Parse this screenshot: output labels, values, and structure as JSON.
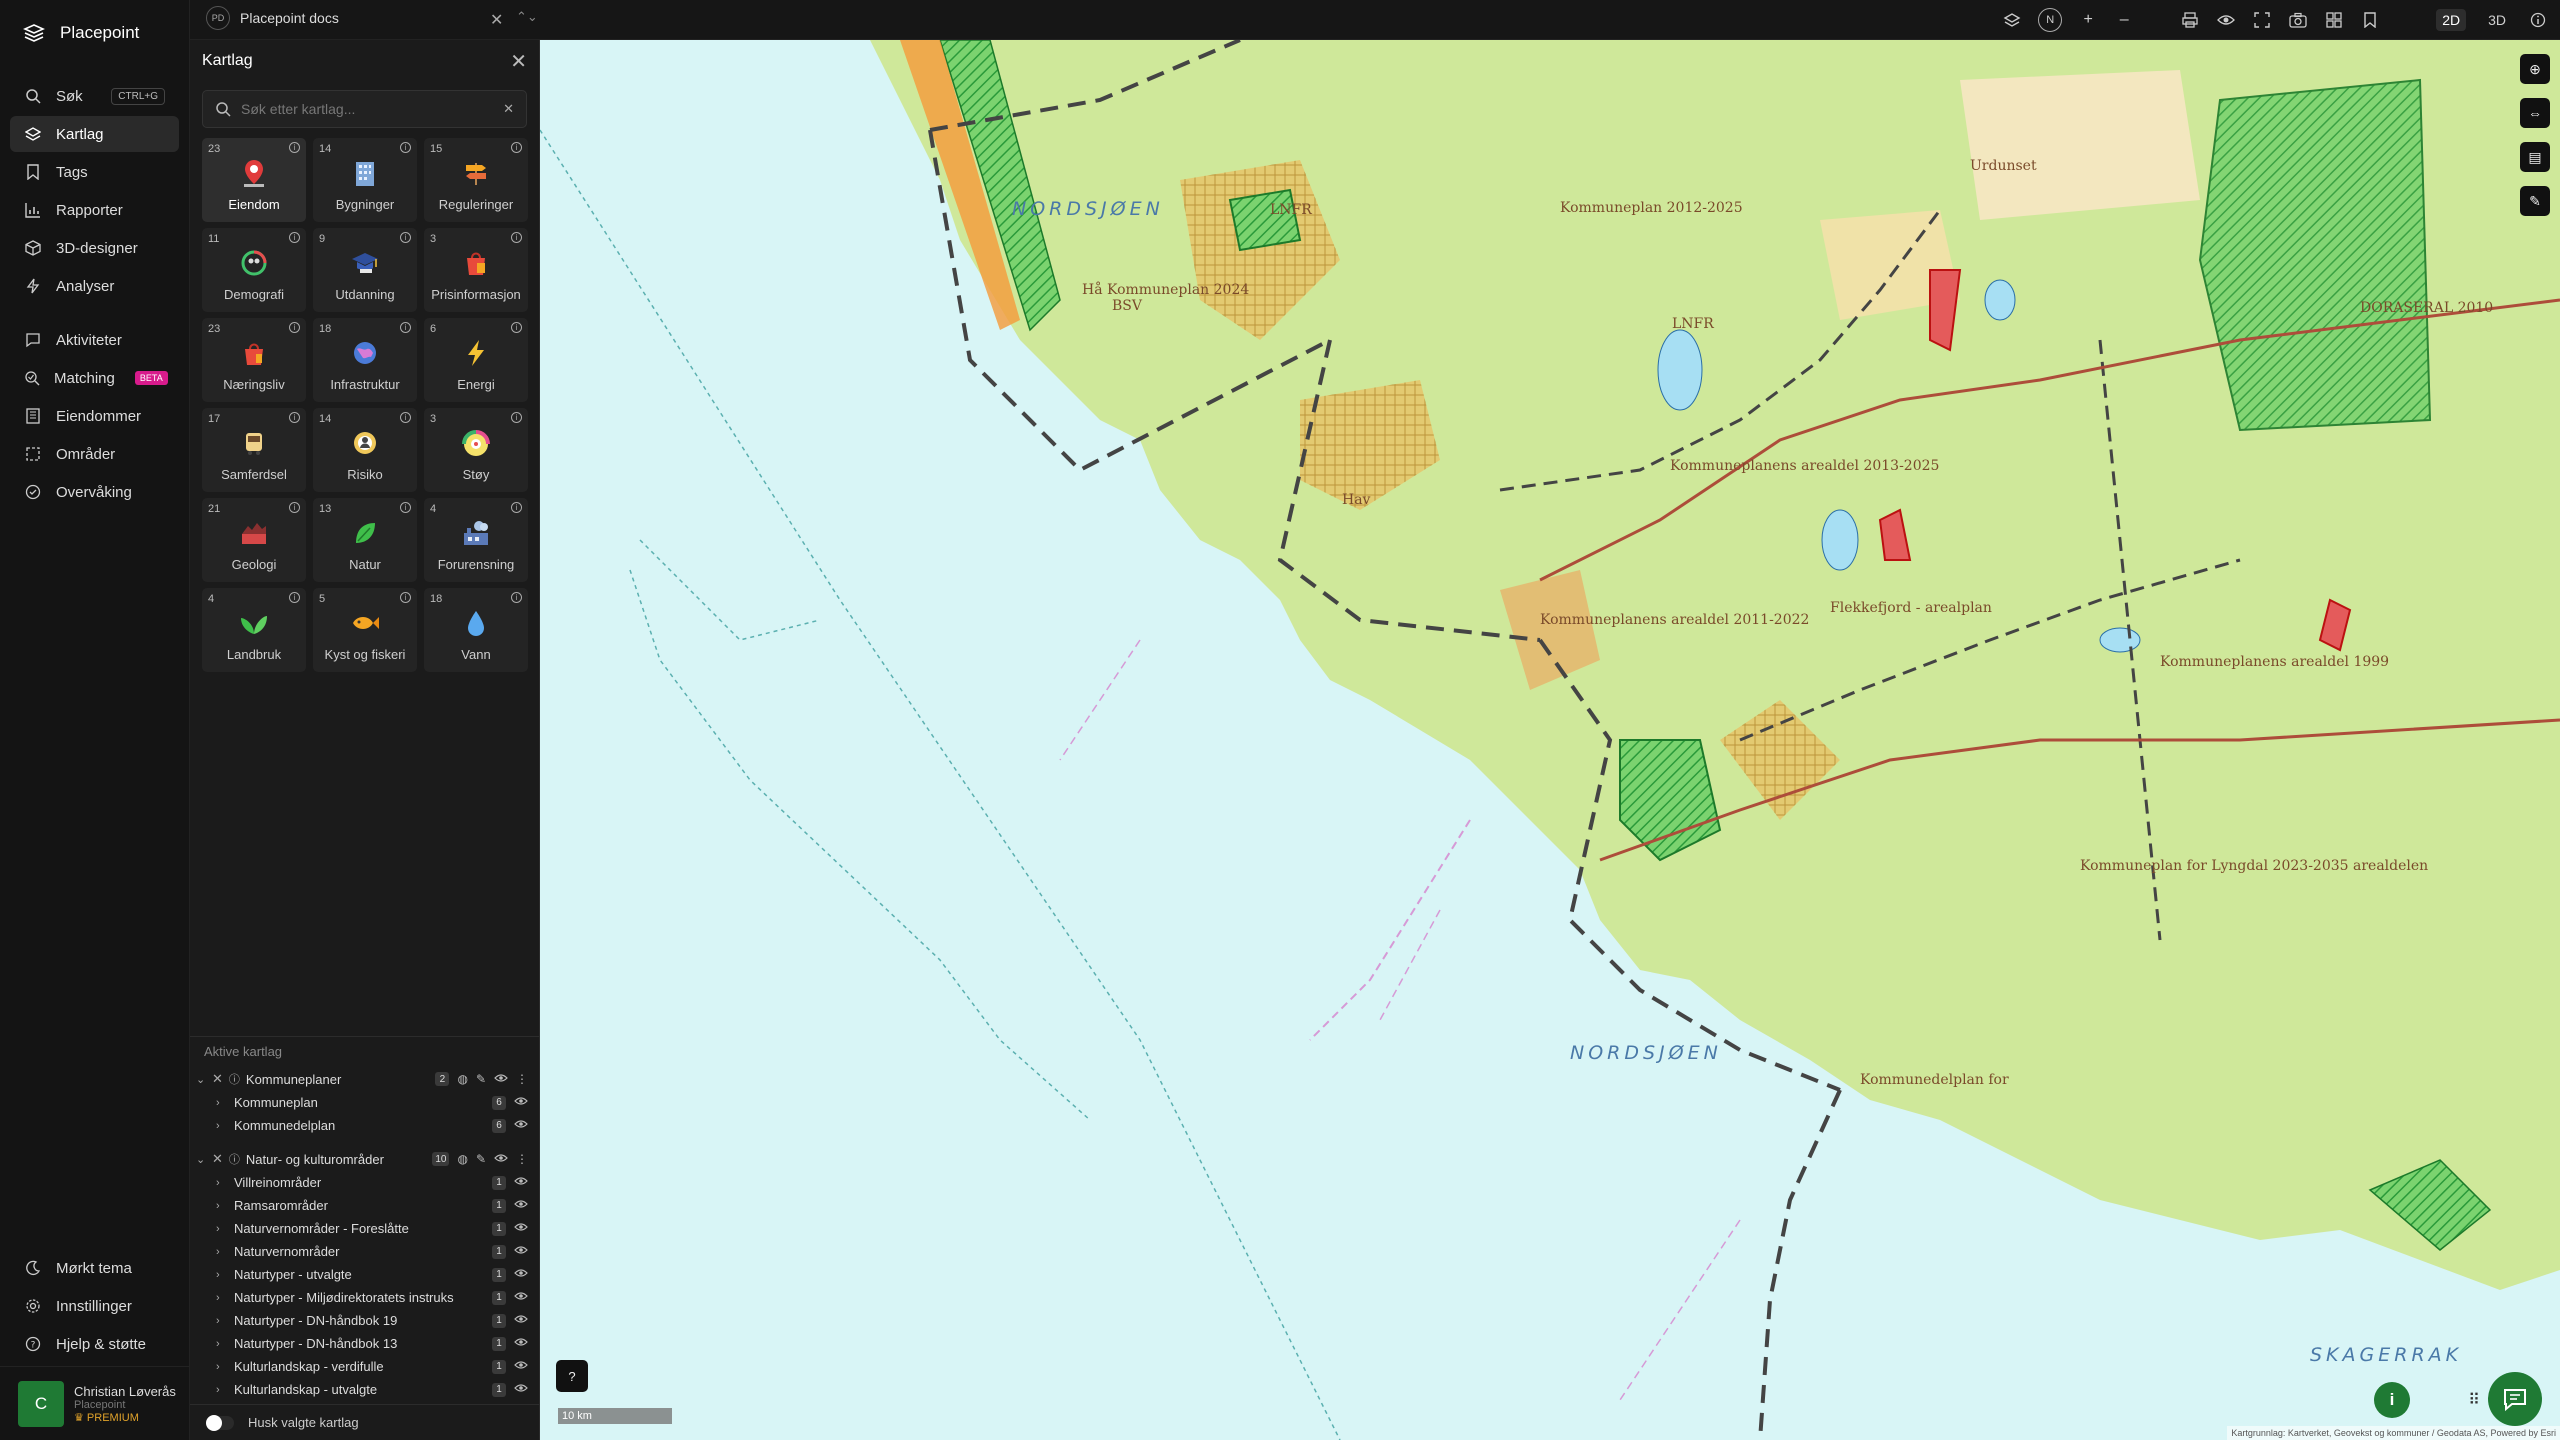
{
  "app": {
    "name": "Placepoint"
  },
  "nav": {
    "items": [
      {
        "label": "Søk",
        "icon": "search-icon",
        "shortcut": "CTRL+G"
      },
      {
        "label": "Kartlag",
        "icon": "layers-icon",
        "active": true
      },
      {
        "label": "Tags",
        "icon": "bookmark-icon"
      },
      {
        "label": "Rapporter",
        "icon": "chart-icon"
      },
      {
        "label": "3D-designer",
        "icon": "cube-icon"
      },
      {
        "label": "Analyser",
        "icon": "bolt-icon"
      }
    ],
    "items2": [
      {
        "label": "Aktiviteter",
        "icon": "chat-icon"
      },
      {
        "label": "Matching",
        "icon": "match-icon",
        "badge": "BETA"
      },
      {
        "label": "Eiendommer",
        "icon": "building-icon"
      },
      {
        "label": "Områder",
        "icon": "area-icon"
      },
      {
        "label": "Overvåking",
        "icon": "monitor-icon"
      }
    ],
    "bottom": [
      {
        "label": "Mørkt tema",
        "icon": "moon-icon"
      },
      {
        "label": "Innstillinger",
        "icon": "gear-icon"
      },
      {
        "label": "Hjelp & støtte",
        "icon": "help-icon"
      }
    ]
  },
  "user": {
    "initial": "C",
    "name": "Christian Løverås",
    "org": "Placepoint",
    "plan": "PREMIUM"
  },
  "topbar": {
    "doc_badge": "PD",
    "doc_title": "Placepoint docs",
    "dim_2d": "2D",
    "dim_3d": "3D",
    "compass": "N"
  },
  "panel": {
    "title": "Kartlag",
    "search_placeholder": "Søk etter kartlag...",
    "tiles": [
      {
        "count": "23",
        "label": "Eiendom",
        "icon": "pin-icon",
        "active": true
      },
      {
        "count": "14",
        "label": "Bygninger",
        "icon": "building-icon"
      },
      {
        "count": "15",
        "label": "Reguleringer",
        "icon": "signpost-icon"
      },
      {
        "count": "11",
        "label": "Demografi",
        "icon": "demography-icon"
      },
      {
        "count": "9",
        "label": "Utdanning",
        "icon": "graduation-icon"
      },
      {
        "count": "3",
        "label": "Prisinformasjon",
        "icon": "shopping-bag-icon"
      },
      {
        "count": "23",
        "label": "Næringsliv",
        "icon": "business-icon"
      },
      {
        "count": "18",
        "label": "Infrastruktur",
        "icon": "globe-icon"
      },
      {
        "count": "6",
        "label": "Energi",
        "icon": "lightning-icon"
      },
      {
        "count": "17",
        "label": "Samferdsel",
        "icon": "bus-icon"
      },
      {
        "count": "14",
        "label": "Risiko",
        "icon": "risk-icon"
      },
      {
        "count": "3",
        "label": "Støy",
        "icon": "noise-gauge-icon"
      },
      {
        "count": "21",
        "label": "Geologi",
        "icon": "geology-icon"
      },
      {
        "count": "13",
        "label": "Natur",
        "icon": "leaf-icon"
      },
      {
        "count": "4",
        "label": "Forurensning",
        "icon": "factory-icon"
      },
      {
        "count": "4",
        "label": "Landbruk",
        "icon": "sprout-icon"
      },
      {
        "count": "5",
        "label": "Kyst og fiskeri",
        "icon": "fish-icon"
      },
      {
        "count": "18",
        "label": "Vann",
        "icon": "water-drop-icon"
      }
    ],
    "active_title": "Aktive kartlag",
    "groups": [
      {
        "label": "Kommuneplaner",
        "count": "2",
        "items": [
          {
            "label": "Kommuneplan",
            "count": "6"
          },
          {
            "label": "Kommunedelplan",
            "count": "6"
          }
        ]
      },
      {
        "label": "Natur- og kulturområder",
        "count": "10",
        "items": [
          {
            "label": "Villreinområder",
            "count": "1"
          },
          {
            "label": "Ramsarområder",
            "count": "1"
          },
          {
            "label": "Naturvernområder - Foreslåtte",
            "count": "1"
          },
          {
            "label": "Naturvernområder",
            "count": "1"
          },
          {
            "label": "Naturtyper - utvalgte",
            "count": "1"
          },
          {
            "label": "Naturtyper - Miljødirektoratets instruks",
            "count": "1"
          },
          {
            "label": "Naturtyper - DN-håndbok 19",
            "count": "1"
          },
          {
            "label": "Naturtyper - DN-håndbok 13",
            "count": "1"
          },
          {
            "label": "Kulturlandskap - verdifulle",
            "count": "1"
          },
          {
            "label": "Kulturlandskap - utvalgte",
            "count": "1"
          }
        ]
      }
    ],
    "remember_label": "Husk valgte kartlag"
  },
  "map": {
    "sea_labels": [
      "NORDSJØEN",
      "NORDSJØEN",
      "SKAGERRAK"
    ],
    "plan_labels": [
      "Hå Kommuneplan 2024",
      "BSV",
      "Kommuneplan 2012-2025",
      "LNFR",
      "LNFR",
      "Kommuneplanens arealdel 2013-2025",
      "Flekkefjord - arealplan",
      "Kommuneplanens arealdel 2011-2022",
      "Kommuneplanens arealdel 1999",
      "Kommuneplan for Lyngdal 2023-2035 arealdelen",
      "Kommunedelplan for",
      "DORASERAL 2010",
      "Urdunset",
      "Hav"
    ],
    "scale": "10 km",
    "attribution": "Kartgrunnlag: Kartverket, Geovekst og kommuner / Geodata AS, Powered by Esri",
    "colors": {
      "sea": "#d8f5f6",
      "land": "#cfe89a",
      "zone": "#e8c76a",
      "protected": "#3fbf4a",
      "boundary": "#444444"
    }
  }
}
